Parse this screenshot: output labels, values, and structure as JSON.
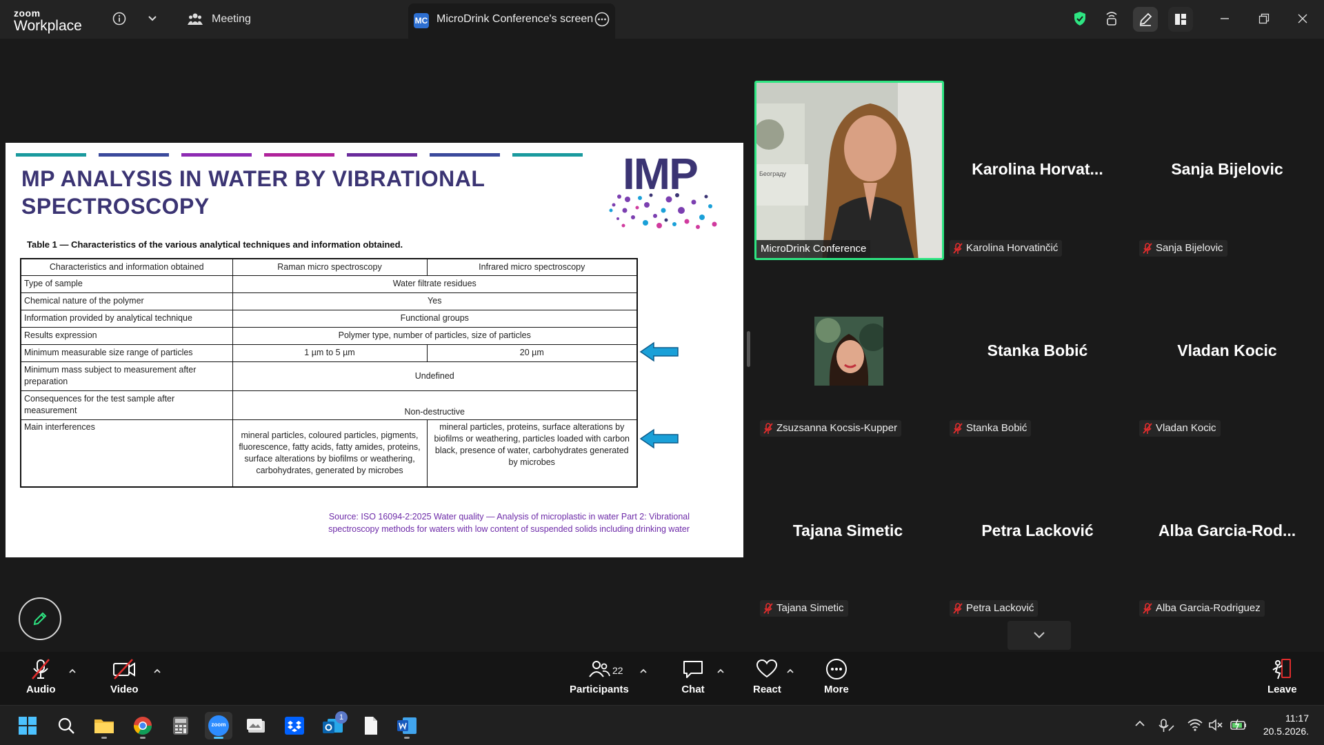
{
  "app": {
    "brand_top": "zoom",
    "brand_bottom": "Workplace",
    "meeting_label": "Meeting",
    "tab_badge": "MC",
    "tab_title": "MicroDrink Conference's screen"
  },
  "slide": {
    "title_line1": "MP ANALYSIS IN WATER BY VIBRATIONAL",
    "title_line2": "SPECTROSCOPY",
    "logo_text": "IMP",
    "stripe_colors": [
      "#1a9a9e",
      "#3b4a9c",
      "#8e2bb3",
      "#b0239b",
      "#6a2c9c",
      "#3b4a9c",
      "#1a9a9e"
    ],
    "table_caption": "Table 1 — Characteristics of the various analytical techniques and information obtained.",
    "header": [
      "Characteristics and information obtained",
      "Raman micro spectroscopy",
      "Infrared micro spectroscopy"
    ],
    "rows": [
      {
        "label": "Type of sample",
        "merged": "Water filtrate residues"
      },
      {
        "label": "Chemical nature of the polymer",
        "merged": "Yes"
      },
      {
        "label": "Information provided by analytical technique",
        "merged": "Functional groups"
      },
      {
        "label": "Results expression",
        "merged": "Polymer type, number of particles, size of particles"
      },
      {
        "label": "Minimum measurable size range of particles",
        "raman": "1 µm to 5 µm",
        "ir": "20 µm"
      },
      {
        "label": "Minimum mass subject to measurement after preparation",
        "merged": "Undefined"
      },
      {
        "label": "Consequences for the test sample after measurement",
        "merged": "Non-destructive"
      },
      {
        "label": "Main interferences",
        "raman": "mineral particles, coloured particles, pigments, fluorescence, fatty acids, fatty amides, proteins, surface alterations by biofilms or weathering, carbohydrates, generated by microbes",
        "ir": "mineral particles, proteins, surface alterations by biofilms or weathering, particles loaded with carbon black, presence of water, carbohydrates generated by microbes"
      }
    ],
    "source_line1": "Source: ISO 16094-2:2025 Water quality — Analysis of microplastic in water Part 2: Vibrational",
    "source_line2": "spectroscopy methods for waters with low content of suspended solids including drinking water"
  },
  "gallery": {
    "featured_name": "MicroDrink Conference",
    "tiles": [
      {
        "big": "Karolina  Horvat...",
        "label": "Karolina Horvatinčić"
      },
      {
        "big": "Sanja Bijelovic",
        "label": "Sanja Bijelovic"
      },
      {
        "big": "",
        "label": "Zsuzsanna Kocsis-Kupper"
      },
      {
        "big": "Stanka Bobić",
        "label": "Stanka Bobić"
      },
      {
        "big": "Vladan Kocic",
        "label": "Vladan Kocic"
      },
      {
        "big": "Tajana Simetic",
        "label": "Tajana Simetic"
      },
      {
        "big": "Petra Lacković",
        "label": "Petra Lacković"
      },
      {
        "big": "Alba  Garcia-Rod...",
        "label": "Alba Garcia-Rodriguez"
      }
    ]
  },
  "toolbar": {
    "audio": "Audio",
    "video": "Video",
    "participants": "Participants",
    "participants_count": "22",
    "chat": "Chat",
    "react": "React",
    "more": "More",
    "leave": "Leave"
  },
  "taskbar": {
    "time": "11:17",
    "date": "20.5.2026.",
    "mail_badge": "1",
    "zoom_icon_text": "zoom"
  },
  "colors": {
    "accent_green": "#2ee582",
    "slide_title": "#3b3473",
    "source_purple": "#6d2aa8",
    "arrow_blue": "#1aa0d8",
    "muted_red": "#e02d2d"
  }
}
